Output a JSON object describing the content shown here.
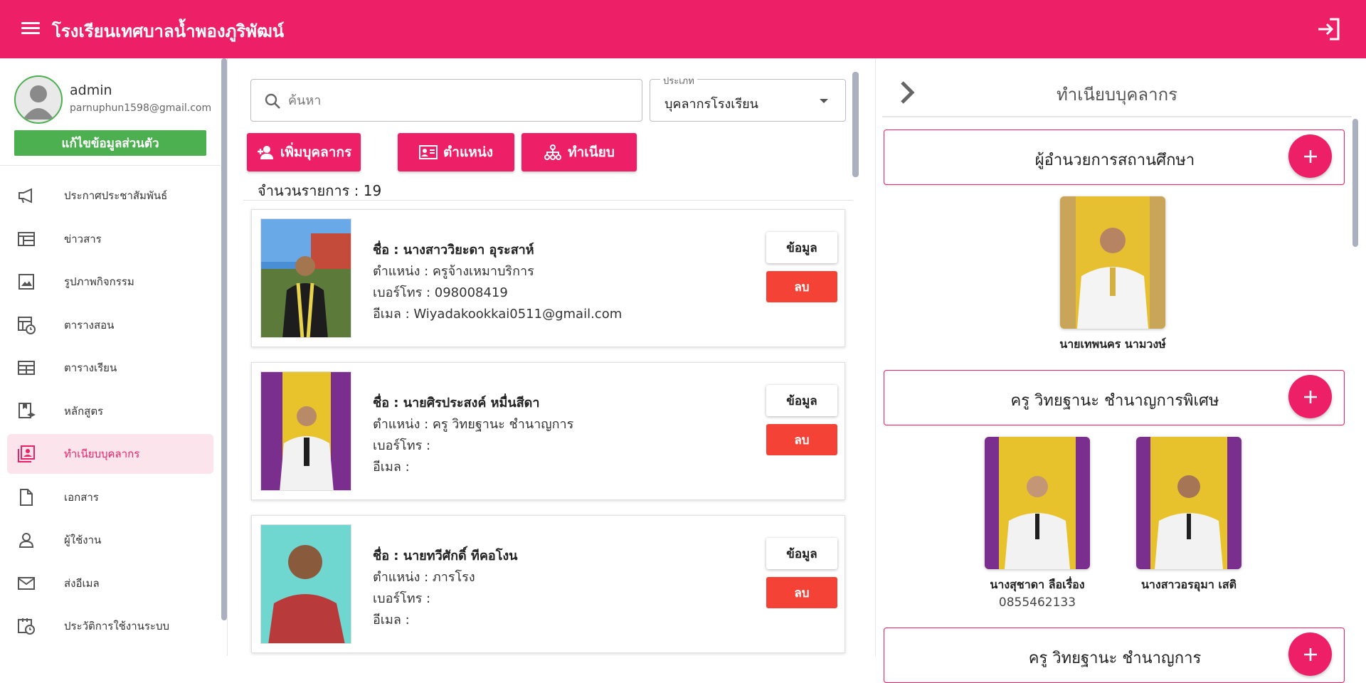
{
  "app": {
    "title": "โรงเรียนเทศบาลน้ำพองภูริพัฒน์",
    "brand_color": "#EC1F67"
  },
  "profile": {
    "name": "admin",
    "email": "parnuphun1598@gmail.com",
    "edit_label": "แก้ไขข้อมูลส่วนตัว"
  },
  "sidebar": {
    "items": [
      {
        "label": "ประกาศประชาสัมพันธ์",
        "icon": "megaphone-icon"
      },
      {
        "label": "ข่าวสาร",
        "icon": "news-icon"
      },
      {
        "label": "รูปภาพกิจกรรม",
        "icon": "image-icon"
      },
      {
        "label": "ตารางสอน",
        "icon": "schedule-icon"
      },
      {
        "label": "ตารางเรียน",
        "icon": "table-icon"
      },
      {
        "label": "หลักสูตร",
        "icon": "curriculum-icon"
      },
      {
        "label": "ทำเนียบบุคลากร",
        "icon": "directory-icon",
        "active": true
      },
      {
        "label": "เอกสาร",
        "icon": "document-icon"
      },
      {
        "label": "ผู้ใช้งาน",
        "icon": "user-icon"
      },
      {
        "label": "ส่งอีเมล",
        "icon": "email-icon"
      },
      {
        "label": "ประวัติการใช้งานระบบ",
        "icon": "history-icon"
      }
    ]
  },
  "search": {
    "placeholder": "ค้นหา",
    "value": ""
  },
  "type_filter": {
    "legend": "ประเภท",
    "value": "บุคลากรโรงเรียน"
  },
  "actions": {
    "add_staff": "เพิ่มบุคลากร",
    "positions": "ตำแหน่ง",
    "directory": "ทำเนียบ"
  },
  "count_label": "จำนวนรายการ : 19",
  "staff_cards": [
    {
      "name": "ชื่อ : นางสาววิยะดา อุระสาห์",
      "position": "ตำแหน่ง : ครูจ้างเหมาบริการ",
      "phone": "เบอร์โทร : 098008419",
      "email": "อีเมล : Wiyadakookkai0511@gmail.com",
      "info_label": "ข้อมูล",
      "delete_label": "ลบ"
    },
    {
      "name": "ชื่อ : นายศิรประสงค์ หมื่นสีดา",
      "position": "ตำแหน่ง : ครู วิทยฐานะ ชำนาญการ",
      "phone": "เบอร์โทร :",
      "email": "อีเมล :",
      "info_label": "ข้อมูล",
      "delete_label": "ลบ"
    },
    {
      "name": "ชื่อ : นายทวีศักดิ์ ทีคอโงน",
      "position": "ตำแหน่ง : ภารโรง",
      "phone": "เบอร์โทร :",
      "email": "อีเมล :",
      "info_label": "ข้อมูล",
      "delete_label": "ลบ"
    }
  ],
  "right_panel": {
    "title": "ทำเนียบบุคลากร",
    "sections": [
      {
        "title": "ผู้อำนวยการสถานศึกษา",
        "members": [
          {
            "name": "นายเทพนคร นามวงษ์",
            "phone": ""
          }
        ]
      },
      {
        "title": "ครู วิทยฐานะ ชำนาญการพิเศษ",
        "members": [
          {
            "name": "นางสุชาดา ลือเรื่อง",
            "phone": "0855462133"
          },
          {
            "name": "นางสาวอรอุมา เสติ",
            "phone": ""
          }
        ]
      },
      {
        "title": "ครู วิทยฐานะ ชำนาญการ",
        "members": []
      }
    ]
  }
}
